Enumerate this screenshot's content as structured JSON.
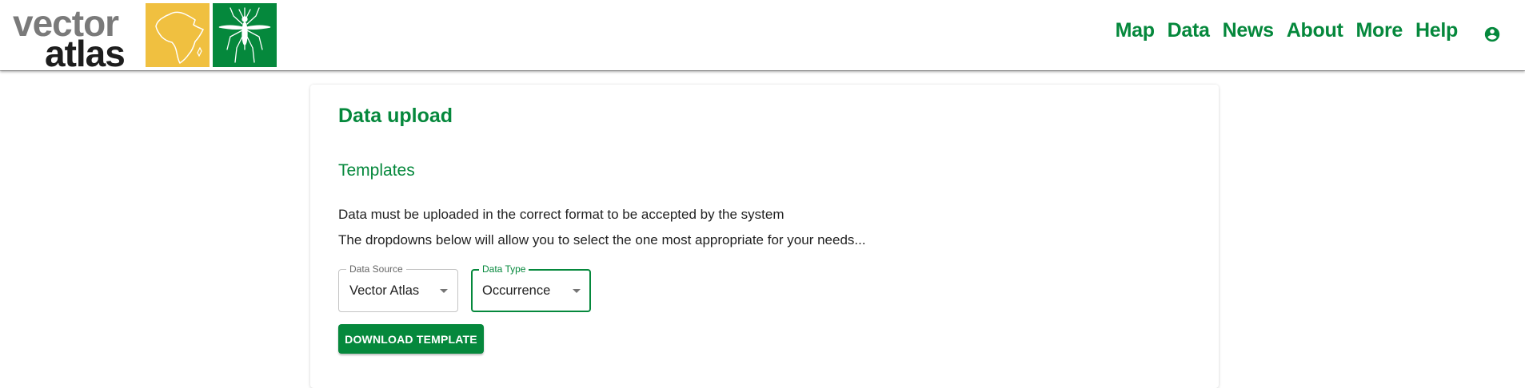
{
  "brand": {
    "word1": "vector",
    "word2": "atlas",
    "color_primary": "#05883c",
    "color_yellow": "#f0c040"
  },
  "nav": {
    "items": [
      {
        "label": "Map"
      },
      {
        "label": "Data"
      },
      {
        "label": "News"
      },
      {
        "label": "About"
      },
      {
        "label": "More"
      },
      {
        "label": "Help"
      }
    ],
    "account_icon": "account-circle-icon"
  },
  "main": {
    "title": "Data upload",
    "section_title": "Templates",
    "paragraph_1": "Data must be uploaded in the correct format to be accepted by the system",
    "paragraph_2": "The dropdowns below will allow you to select the one most appropriate for your needs...",
    "data_source": {
      "label": "Data Source",
      "value": "Vector Atlas"
    },
    "data_type": {
      "label": "Data Type",
      "value": "Occurrence"
    },
    "download_label": "DOWNLOAD TEMPLATE"
  }
}
